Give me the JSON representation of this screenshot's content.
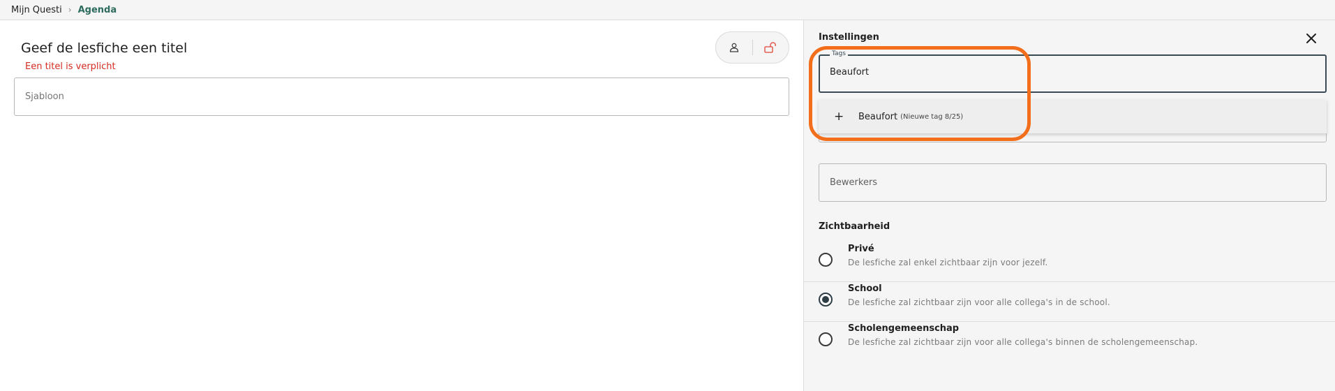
{
  "breadcrumb": {
    "home": "Mijn Questi",
    "current": "Agenda"
  },
  "main": {
    "title": "Geef de lesfiche een titel",
    "title_error": "Een titel is verplicht",
    "template_placeholder": "Sjabloon"
  },
  "settings": {
    "title": "Instellingen",
    "tags": {
      "legend": "Tags",
      "value": "Beaufort",
      "option": {
        "label": "Beaufort",
        "hint": "(Nieuwe tag 8/25)"
      }
    },
    "editors_placeholder": "Bewerkers",
    "visibility": {
      "title": "Zichtbaarheid",
      "selected": "School",
      "options": [
        {
          "label": "Privé",
          "description": "De lesfiche zal enkel zichtbaar zijn voor jezelf."
        },
        {
          "label": "School",
          "description": "De lesfiche zal zichtbaar zijn voor alle collega's in de school."
        },
        {
          "label": "Scholengemeenschap",
          "description": "De lesfiche zal zichtbaar zijn voor alle collega's binnen de scholengemeenschap."
        }
      ]
    }
  },
  "colors": {
    "accent": "#2c6b5d",
    "error": "#d62b1f",
    "highlight": "#f26e1a",
    "lock_icon": "#e0453a"
  },
  "icons": {
    "breadcrumb_separator": "chevron-right-icon",
    "owner": "user-icon",
    "lock": "unlock-icon",
    "close": "close-icon",
    "add": "plus-icon"
  }
}
